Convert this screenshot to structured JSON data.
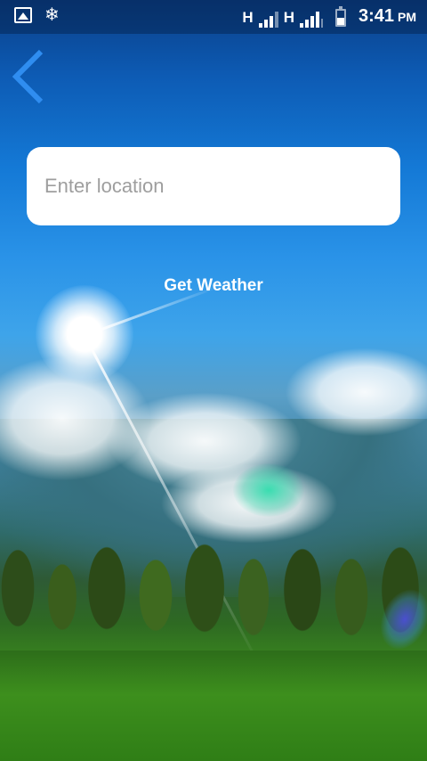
{
  "status_bar": {
    "left_icons": [
      "image-icon",
      "snowflake-icon"
    ],
    "network_1": "H",
    "network_2": "H",
    "time": "3:41",
    "ampm": "PM",
    "battery_level": 0.5
  },
  "nav": {
    "back_icon": "chevron-left-icon",
    "back_color": "#2f8df0"
  },
  "search": {
    "placeholder": "Enter location",
    "value": ""
  },
  "actions": {
    "get_weather_label": "Get Weather"
  }
}
